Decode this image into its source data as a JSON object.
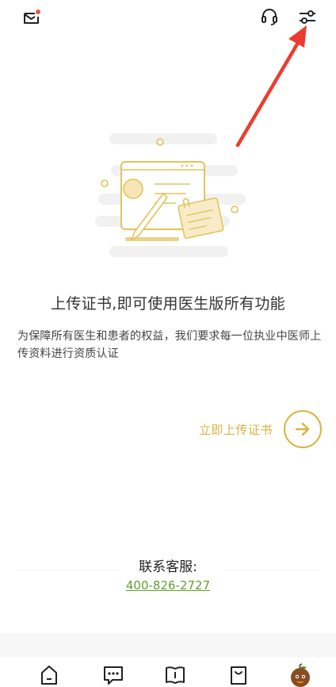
{
  "header": {
    "mail_icon": "mail-icon",
    "mail_badge_color": "#e25a4a",
    "headset_icon": "headset-icon",
    "filter_icon": "sliders-icon"
  },
  "annotation": {
    "arrow_color": "#ee3b2f"
  },
  "main": {
    "headline": "上传证书,即可使用医生版所有功能",
    "description": "为保障所有医生和患者的权益，我们要求每一位执业中医师上传资料进行资质认证",
    "upload_label": "立即上传证书",
    "accent_color": "#d9b442"
  },
  "contact": {
    "title": "联系客服:",
    "phone": "400-826-2727",
    "phone_color": "#5fa02f"
  },
  "tabbar": {
    "items": [
      {
        "icon": "home-icon"
      },
      {
        "icon": "chat-icon"
      },
      {
        "icon": "book-icon"
      },
      {
        "icon": "bag-icon"
      },
      {
        "icon": "profile-avatar-icon"
      }
    ]
  }
}
